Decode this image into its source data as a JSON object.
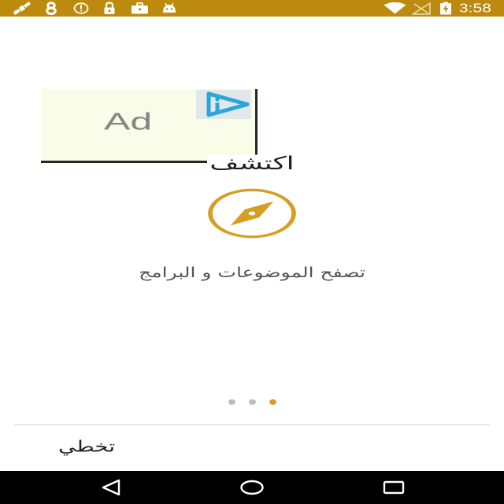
{
  "status_bar": {
    "time": "3:58",
    "notification_icons": [
      "satellite-icon",
      "app-notification-icon",
      "alert-circle-icon",
      "lock-icon",
      "briefcase-icon",
      "android-icon"
    ],
    "system_icons": [
      "wifi-icon",
      "signal-off-icon",
      "battery-charging-icon"
    ]
  },
  "ad_banner": {
    "label": "Ad",
    "choices_icon": "adchoices-icon"
  },
  "onboarding": {
    "title": "اكتشف",
    "icon": "compass-icon",
    "subtitle": "تصفح الموضوعات و البرامج"
  },
  "pager": {
    "count": 3,
    "active_index": 2
  },
  "footer": {
    "skip_label": "تخطي"
  },
  "nav_bar": {
    "buttons": [
      "back-icon",
      "home-icon",
      "recents-icon"
    ]
  },
  "theme": {
    "status_bar": "#BC8A0E",
    "accent": "#D49F22",
    "dot_inactive": "#BDBDBD",
    "ad_background": "#F8FCE8",
    "adchoices_blue": "#2AA6DB",
    "divider": "#D6D6D6",
    "nav_bar": "#000000"
  }
}
